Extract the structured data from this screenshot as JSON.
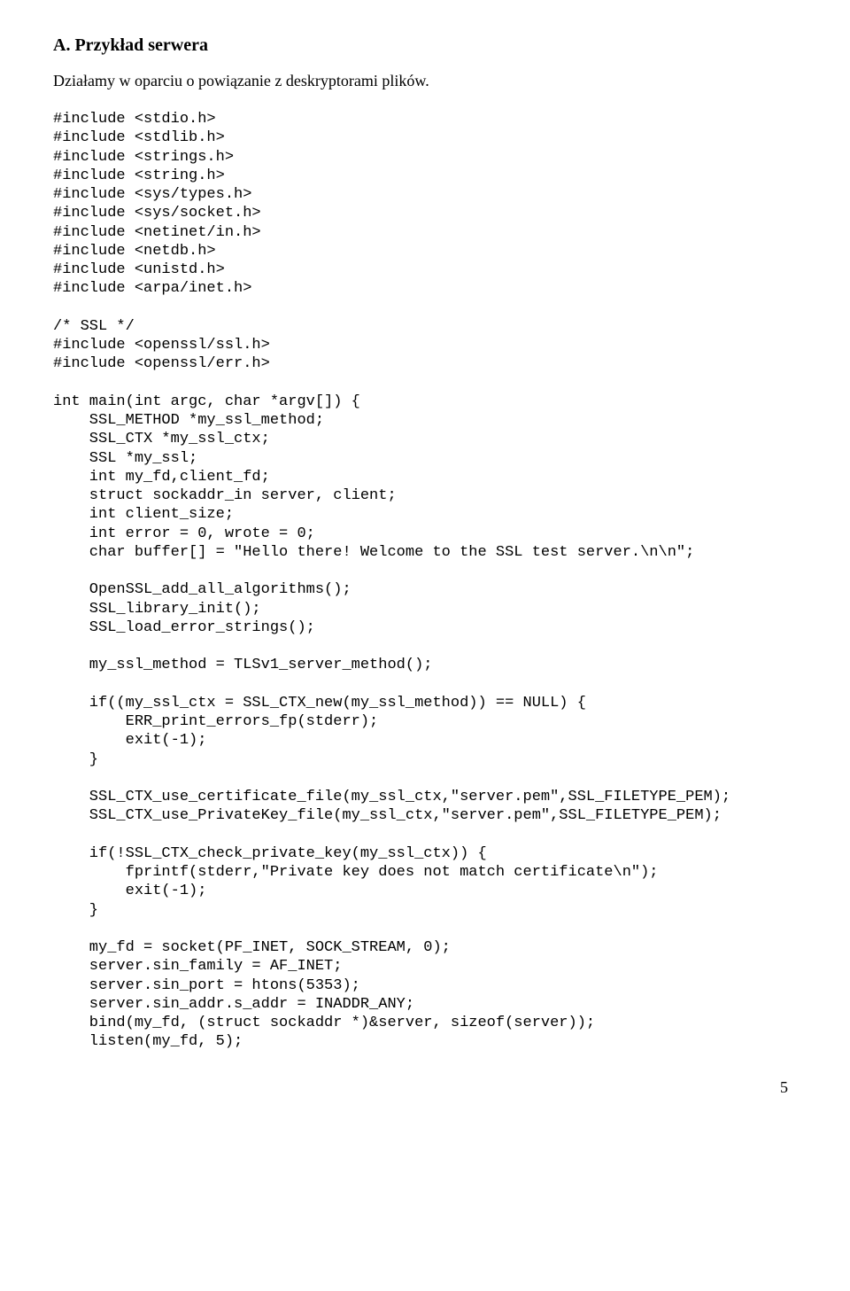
{
  "heading": "A. Przykład serwera",
  "intro": "Działamy w oparciu o powiązanie z deskryptorami plików.",
  "code": "#include <stdio.h>\n#include <stdlib.h>\n#include <strings.h>\n#include <string.h>\n#include <sys/types.h>\n#include <sys/socket.h>\n#include <netinet/in.h>\n#include <netdb.h>\n#include <unistd.h>\n#include <arpa/inet.h>\n\n/* SSL */\n#include <openssl/ssl.h>\n#include <openssl/err.h>\n\nint main(int argc, char *argv[]) {\n    SSL_METHOD *my_ssl_method;\n    SSL_CTX *my_ssl_ctx;\n    SSL *my_ssl;\n    int my_fd,client_fd;\n    struct sockaddr_in server, client;\n    int client_size;\n    int error = 0, wrote = 0;\n    char buffer[] = \"Hello there! Welcome to the SSL test server.\\n\\n\";\n\n    OpenSSL_add_all_algorithms();\n    SSL_library_init();\n    SSL_load_error_strings();\n\n    my_ssl_method = TLSv1_server_method();\n\n    if((my_ssl_ctx = SSL_CTX_new(my_ssl_method)) == NULL) {\n        ERR_print_errors_fp(stderr);\n        exit(-1);\n    }\n\n    SSL_CTX_use_certificate_file(my_ssl_ctx,\"server.pem\",SSL_FILETYPE_PEM);\n    SSL_CTX_use_PrivateKey_file(my_ssl_ctx,\"server.pem\",SSL_FILETYPE_PEM);\n\n    if(!SSL_CTX_check_private_key(my_ssl_ctx)) {\n        fprintf(stderr,\"Private key does not match certificate\\n\");\n        exit(-1);\n    }\n\n    my_fd = socket(PF_INET, SOCK_STREAM, 0);\n    server.sin_family = AF_INET;\n    server.sin_port = htons(5353);\n    server.sin_addr.s_addr = INADDR_ANY;\n    bind(my_fd, (struct sockaddr *)&server, sizeof(server));\n    listen(my_fd, 5);",
  "page_number": "5"
}
